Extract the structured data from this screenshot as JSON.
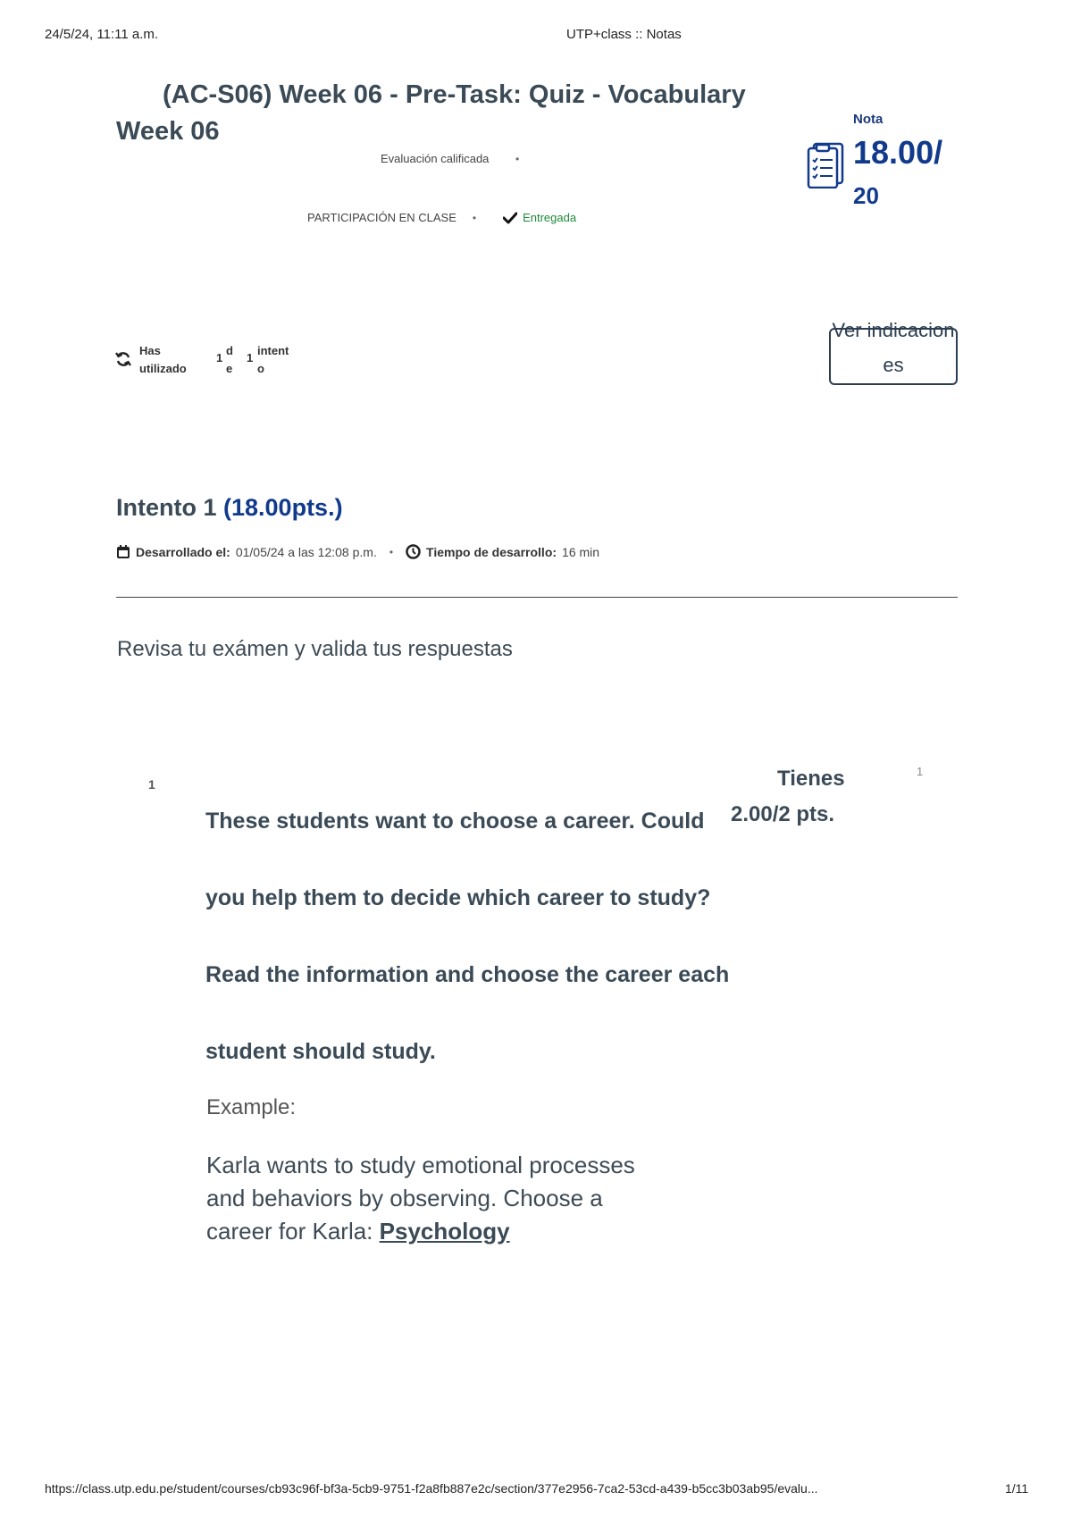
{
  "print_header": {
    "datetime": "24/5/24, 11:11 a.m.",
    "page_title": "UTP+class :: Notas"
  },
  "print_footer": {
    "url": "https://class.utp.edu.pe/student/courses/cb93c96f-bf3a-5cb9-9751-f2a8fb887e2c/section/377e2956-7ca2-53cd-a439-b5cc3b03ab95/evalu...",
    "page_number": "1/11"
  },
  "assessment": {
    "title_line1": "(AC-S06) Week 06 - Pre-Task: Quiz - Vocabulary",
    "title_line2": "Week 06",
    "type_label": "Evaluación calificada",
    "category_label": "PARTICIPACIÓN EN CLASE",
    "status_label": "Entregada"
  },
  "grade": {
    "label": "Nota",
    "score": "18.00/",
    "total": "20"
  },
  "attempts": {
    "prefix_1": "Has",
    "prefix_2": "utilizado",
    "used": "1",
    "of_1": "d",
    "of_2": "e",
    "allowed": "1",
    "suffix_1": "intent",
    "suffix_2": "o"
  },
  "view_instructions_button": "Ver indicaciones",
  "attempt": {
    "title": "Intento 1",
    "points": "(18.00pts.)",
    "developed_label": "Desarrollado el:",
    "developed_value": "01/05/24 a las 12:08 p.m.",
    "duration_label": "Tiempo de desarrollo:",
    "duration_value": "16 min"
  },
  "review_heading": "Revisa tu exámen y valida tus respuestas",
  "question": {
    "number": "1",
    "text": "These students want to choose a career. Could you help them to decide which career to study? Read the information and choose the career each student should study.",
    "score_label": "Tienes",
    "score_value": "2.00/2 pts.",
    "side_number": "1",
    "example_label": "Example:",
    "example_text": "Karla wants to study emotional processes and behaviors by observing. Choose a career for Karla: ",
    "example_answer": "Psychology"
  },
  "colors": {
    "accent": "#123a8c",
    "success": "#1e8a3a",
    "text_dark": "#3a4a56"
  },
  "icons": [
    "clipboard-icon",
    "refresh-icon",
    "calendar-icon",
    "clock-icon",
    "checkmark-icon"
  ]
}
